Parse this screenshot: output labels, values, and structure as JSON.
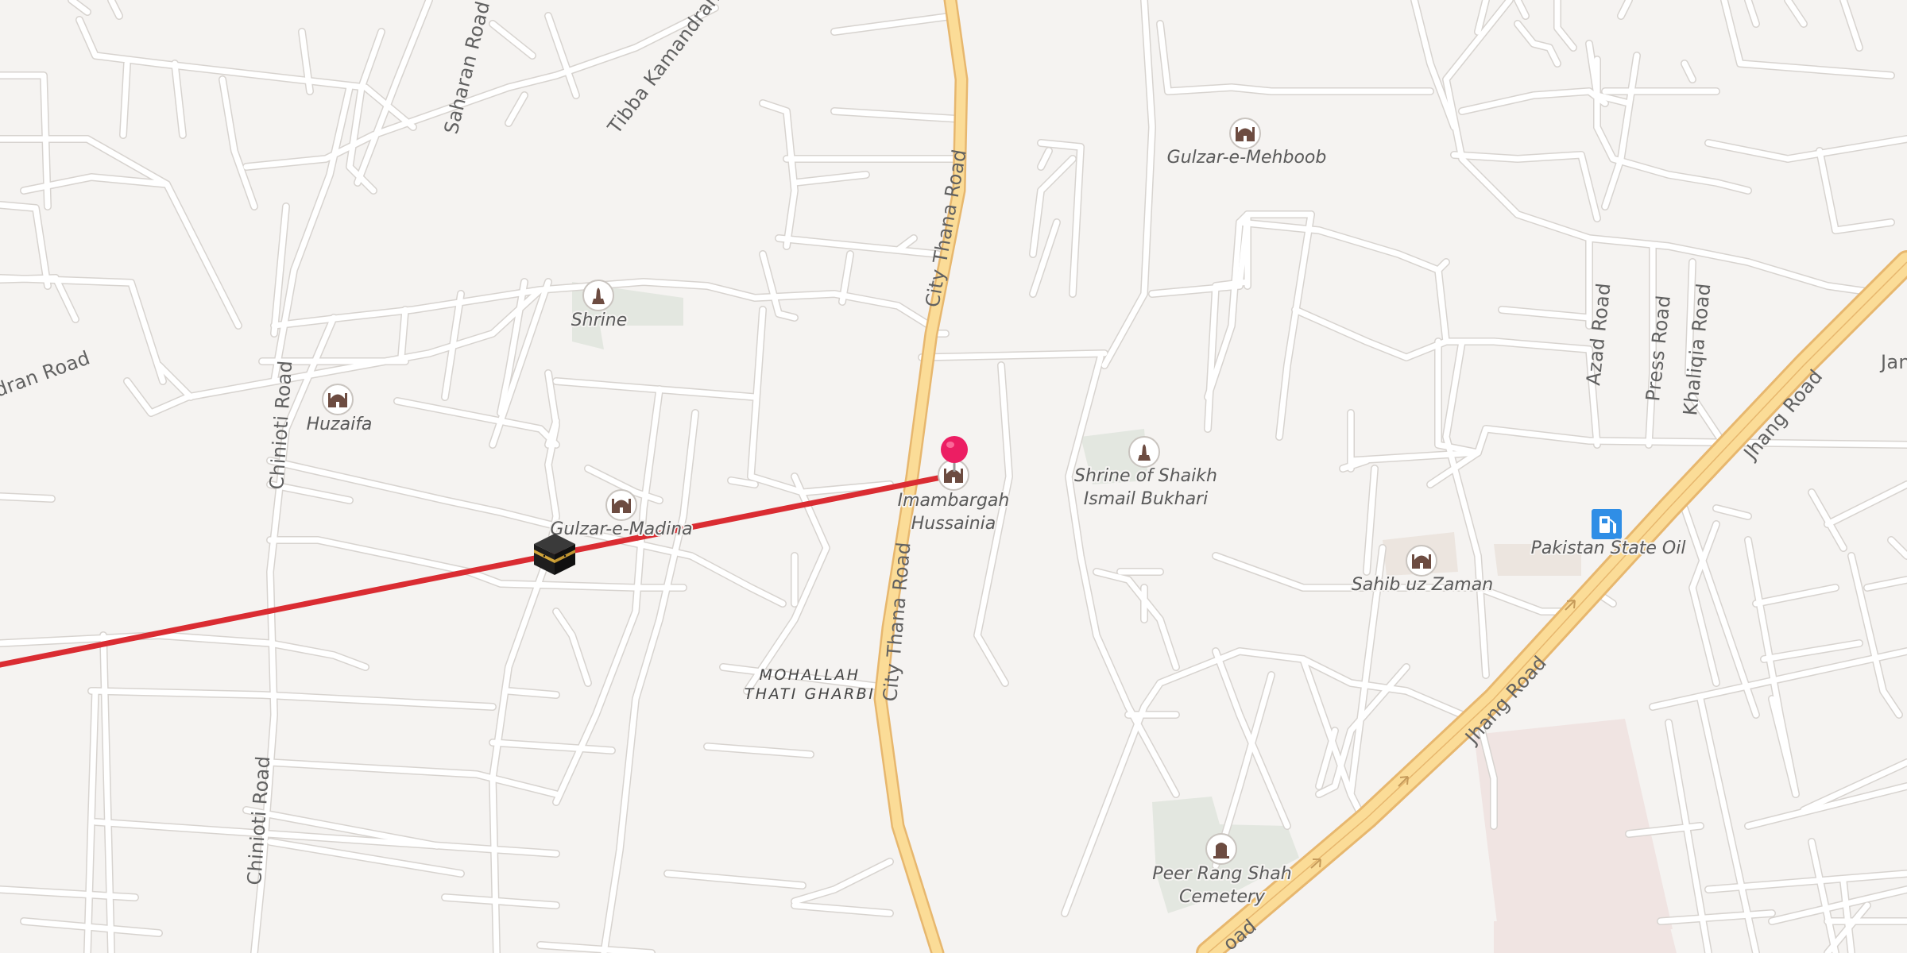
{
  "map": {
    "roads": {
      "city_thana_road": "City Thana Road",
      "jhang_road": "Jhang Road",
      "chinioti_road": "Chinioti Road",
      "saharan_road": "Saharan Road",
      "tibba_kamandran_road": "Tibba Kamandran Road",
      "azad_road": "Azad Road",
      "press_road": "Press Road",
      "khaliqia_road": "Khaliqia Road",
      "kamandran_road_partial": "dran Road",
      "jan_partial": "Jan",
      "jhang_road_partial": "oad"
    },
    "areas": {
      "mohallah_line1": "MOHALLAH",
      "mohallah_line2": "THATI GHARBI"
    },
    "pois": {
      "gulzar_mehboob": "Gulzar-e-Mehboob",
      "shrine": "Shrine",
      "huzaifa": "Huzaifa",
      "gulzar_madina": "Gulzar-e-Madina",
      "imambargah_line1": "Imambargah",
      "imambargah_line2": "Hussainia",
      "shaikh_line1": "Shrine of Shaikh",
      "shaikh_line2": "Ismail Bukhari",
      "pso": "Pakistan State Oil",
      "sahib_uz_zaman": "Sahib uz Zaman",
      "peer_line1": "Peer Rang Shah",
      "peer_line2": "Cemetery"
    },
    "icons": {
      "mosque": "mosque-icon",
      "shrine": "shrine-icon",
      "cemetery": "cemetery-icon",
      "fuel": "fuel-station-icon",
      "kaaba": "kaaba-icon",
      "pin": "location-pin-icon"
    },
    "colors": {
      "background": "#f5f3f1",
      "road": "#ffffff",
      "road_casing": "#d7d3cf",
      "primary_road": "#fbdc97",
      "primary_casing": "#e7b76e",
      "route_line": "#da2c32",
      "pin": "#ec1e63",
      "fuel": "#2f8ee6",
      "park": "#e3e7e0"
    }
  }
}
